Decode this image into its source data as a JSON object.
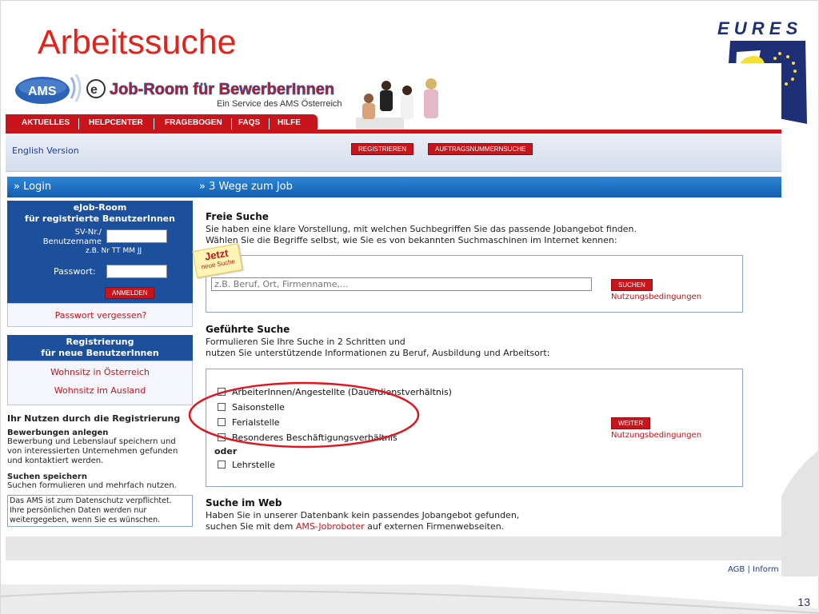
{
  "slide": {
    "title": "Arbeitssuche",
    "logo_text": "E U R E S",
    "page_number": "13"
  },
  "header": {
    "ams_logo_text": "AMS",
    "ejob_logo_text": "Job-Room für BewerberInnen",
    "service_text": "Ein Service des AMS Österreich"
  },
  "nav": {
    "items": [
      "AKTUELLES",
      "HELPCENTER",
      "FRAGEBOGEN",
      "FAQS",
      "HILFE"
    ]
  },
  "subbar": {
    "english_link": "English Version",
    "register_button": "REGISTRIEREN",
    "order_search_button": "AUFTRAGSNUMMERNSUCHE"
  },
  "login": {
    "header": "» Login",
    "title_line1": "eJob-Room",
    "title_line2": "für registrierte BenutzerInnen",
    "sv_label_line1": "SV-Nr./",
    "sv_label_line2": "Benutzername",
    "sv_hint": "z.B. Nr TT MM JJ",
    "password_label": "Passwort:",
    "login_button": "ANMELDEN",
    "forgot_link": "Passwort vergessen?"
  },
  "registration": {
    "title_line1": "Registrierung",
    "title_line2": "für neue BenutzerInnen",
    "link_austria": "Wohnsitz in Österreich",
    "link_abroad": "Wohnsitz im Ausland"
  },
  "benefits": {
    "title": "Ihr Nutzen durch die Registrierung",
    "item1_title": "Bewerbungen anlegen",
    "item1_line1": "Bewerbung und Lebenslauf speichern und",
    "item1_line2": "von interessierten Unternehmen gefunden",
    "item1_line3": "und kontaktiert werden.",
    "item2_title": "Suchen speichern",
    "item2_line1": "Suchen formulieren und mehrfach nutzen.",
    "privacy_line1": "Das AMS ist zum Datenschutz verpflichtet.",
    "privacy_line2": "Ihre persönlichen Daten werden nur",
    "privacy_line3": "weitergegeben, wenn Sie es wünschen."
  },
  "main": {
    "header": "» 3 Wege zum Job",
    "free_search": {
      "title": "Freie Suche",
      "line1": "Sie haben eine klare Vorstellung, mit welchen Suchbegriffen Sie das passende Jobangebot finden.",
      "line2": "Wählen Sie die Begriffe selbst, wie Sie es von bekannten Suchmaschinen im Internet kennen:",
      "badge_line1": "Jetzt",
      "badge_line2": "neue Suche",
      "placeholder": "z.B. Beruf, Ort, Firmenname,...",
      "search_button": "SUCHEN",
      "terms_link": "Nutzungsbedingungen"
    },
    "guided_search": {
      "title": "Geführte Suche",
      "line1": "Formulieren Sie Ihre Suche in 2 Schritten und",
      "line2": "nutzen Sie unterstützende Informationen zu Beruf, Ausbildung und Arbeitsort:",
      "options": [
        "ArbeiterInnen/Angestellte (Dauerdienstverhältnis)",
        "Saisonstelle",
        "Ferialstelle",
        "Besonderes Beschäftigungsverhältnis"
      ],
      "or_label": "oder",
      "apprenticeship": "Lehrstelle",
      "next_button": "WEITER",
      "terms_link": "Nutzungsbedingungen"
    },
    "web_search": {
      "title": "Suche im Web",
      "line1": "Haben Sie in unserer Datenbank kein passendes Jobangebot gefunden,",
      "line2_prefix": "suchen Sie mit dem ",
      "line2_link": "AMS-Jobroboter",
      "line2_suffix": " auf externen Firmenwebseiten."
    }
  },
  "footer": {
    "links": "AGB | Inform"
  },
  "colors": {
    "accent_red": "#c8141b",
    "title_red": "#e2231a",
    "panel_blue": "#1c4f9c",
    "highlight_circle": "#e3141b"
  }
}
